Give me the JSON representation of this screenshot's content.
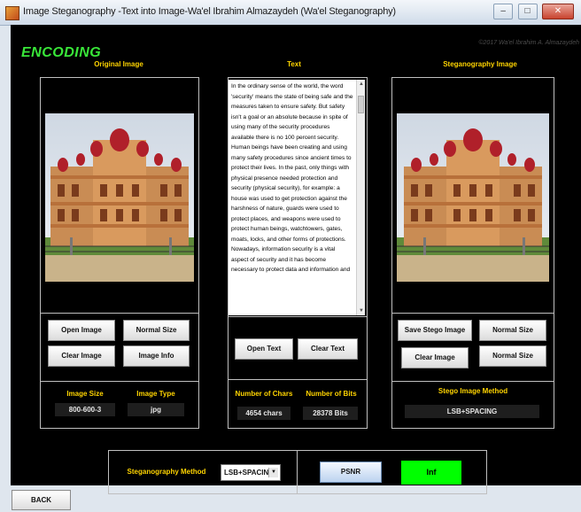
{
  "window": {
    "title": "Image Steganography -Text into Image-Wa'el Ibrahim Almazaydeh (Wa'el Steganography)",
    "minimize": "–",
    "maximize": "□",
    "close": "✕"
  },
  "header": {
    "mode_title": "ENCODING",
    "copyright": "©2017 Wa'el Ibrahim A. Almazaydeh"
  },
  "original_panel": {
    "heading": "Original Image",
    "buttons": {
      "open_image": "Open Image",
      "normal_size": "Normal Size",
      "clear_image": "Clear Image",
      "image_info": "Image Info"
    },
    "info": {
      "size_label": "Image Size",
      "size_value": "800-600-3",
      "type_label": "Image Type",
      "type_value": "jpg"
    }
  },
  "text_panel": {
    "heading": "Text",
    "content": "In the ordinary sense of the world, the word 'security' means the state of being safe and the measures taken to ensure safety. But safety isn't a goal or an absolute because in spite of using many of the security procedures available there is no 100 percent security. Human beings have been creating and using many safety procedures since ancient times to protect their lives. In the past, only things with physical presence needed protection and security (physical security), for example: a house was used to get protection against the harshness of nature, guards were used to protect places, and weapons were used to protect human beings, watchtowers, gates, moats, locks, and other forms of protections.\nNowadays, information security is a vital aspect of security and it has become necessary to protect data and information and",
    "buttons": {
      "open_text": "Open Text",
      "clear_text": "Clear Text"
    },
    "info": {
      "chars_label": "Number of Chars",
      "chars_value": "4654 chars",
      "bits_label": "Number of Bits",
      "bits_value": "28378 Bits"
    }
  },
  "stego_panel": {
    "heading": "Steganography Image",
    "buttons": {
      "save_stego": "Save Stego Image",
      "normal_size": "Normal Size",
      "clear_image": "Clear Image",
      "normal_size_2": "Normal Size"
    },
    "method_label": "Stego Image Method",
    "method_value": "LSB+SPACING"
  },
  "bottom": {
    "method_label": "Steganography Method",
    "method_selected": "LSB+SPACING",
    "psnr_button": "PSNR",
    "psnr_value": "Inf",
    "back_button": "BACK"
  },
  "colors": {
    "accent_yellow": "#ffd400",
    "title_green": "#39e639",
    "psnr_green": "#00ff00",
    "background": "#000000"
  }
}
